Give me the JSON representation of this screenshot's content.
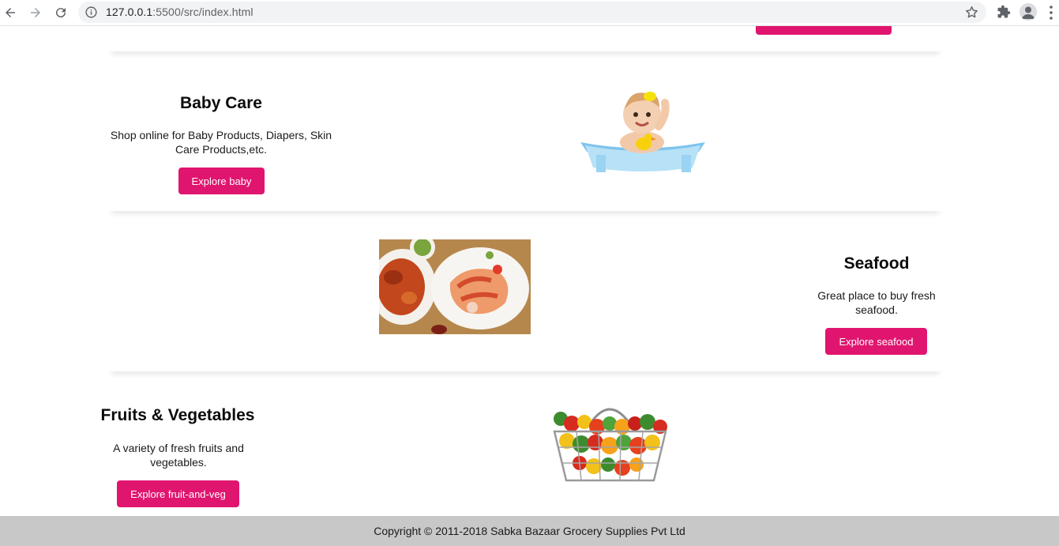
{
  "browser": {
    "url_host": "127.0.0.1",
    "url_path": ":5500/src/index.html"
  },
  "categories": [
    {
      "title": "Baby Care",
      "description": "Shop online for Baby Products, Diapers, Skin Care Products,etc.",
      "button": "Explore baby"
    },
    {
      "title": "Seafood",
      "description": "Great place to buy fresh seafood.",
      "button": "Explore seafood"
    },
    {
      "title": "Fruits & Vegetables",
      "description": "A variety of fresh fruits and vegetables.",
      "button": "Explore fruit-and-veg"
    }
  ],
  "footer": {
    "text": "Copyright © 2011-2018 Sabka Bazaar Grocery Supplies Pvt Ltd"
  },
  "colors": {
    "accent": "#e0156f",
    "footer_bg": "#c8c8c8"
  }
}
